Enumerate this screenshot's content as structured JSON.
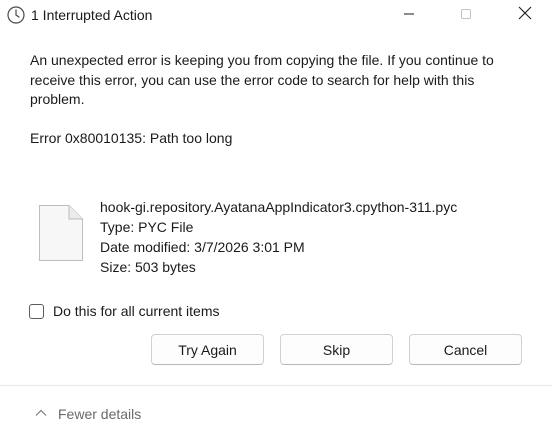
{
  "window": {
    "title": "1 Interrupted Action"
  },
  "titlebar": {
    "icon": "clock-icon",
    "minimize_icon": "minimize-icon",
    "maximize_icon": "maximize-icon",
    "close_icon": "close-icon"
  },
  "message": {
    "text": "An unexpected error is keeping you from copying the file. If you continue to receive this error, you can use the error code to search for help with this problem.",
    "error": "Error 0x80010135: Path too long"
  },
  "file": {
    "icon": "file-icon",
    "name": "hook-gi.repository.AyatanaAppIndicator3.cpython-311.pyc",
    "type": "Type: PYC File",
    "date_modified": "Date modified: 3/7/2026 3:01 PM",
    "size": "Size: 503 bytes"
  },
  "checkbox": {
    "label": "Do this for all current items",
    "checked": false
  },
  "buttons": {
    "try_again": "Try Again",
    "skip": "Skip",
    "cancel": "Cancel"
  },
  "footer": {
    "toggle_icon": "chevron-up-icon",
    "details_label": "Fewer details"
  },
  "colors": {
    "text": "#1a1a1a",
    "muted": "#6a6a6a",
    "border": "#d1d1d1"
  }
}
